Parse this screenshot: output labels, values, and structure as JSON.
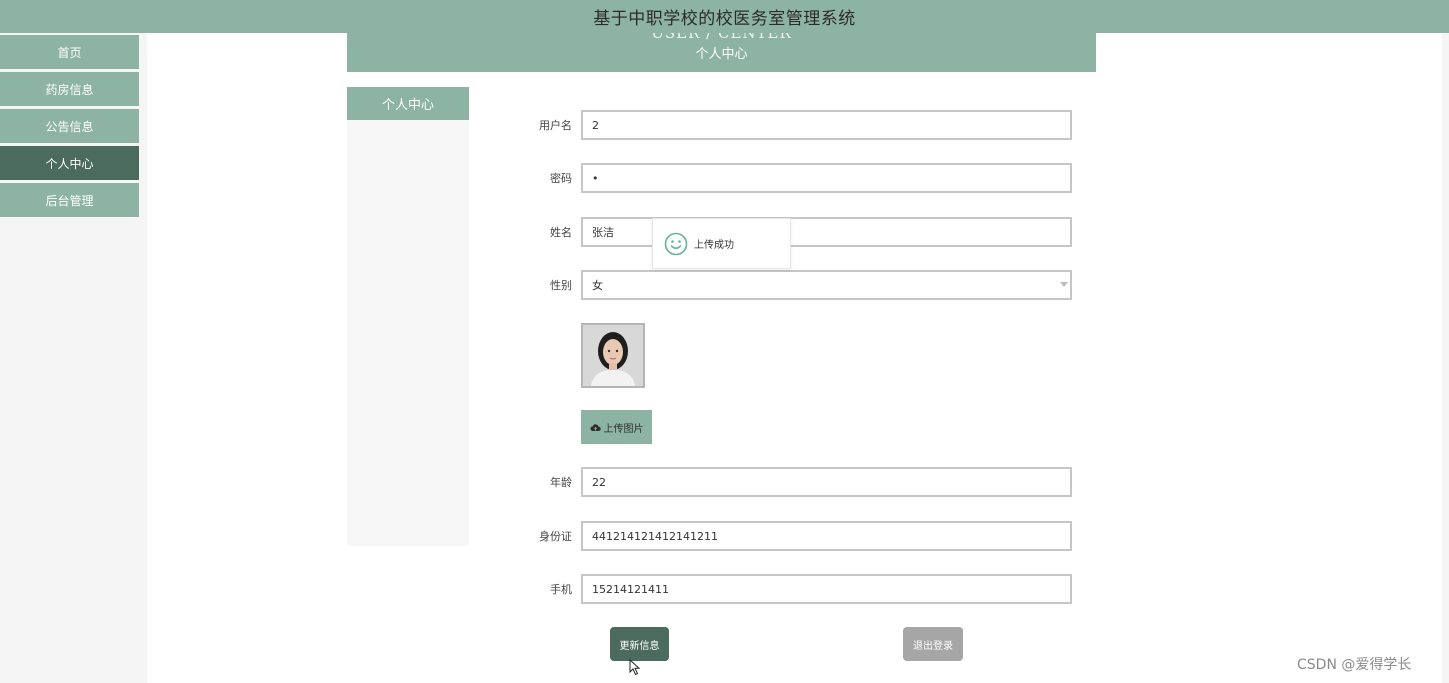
{
  "app": {
    "title": "基于中职学校的校医务室管理系统"
  },
  "sidebar": {
    "items": [
      {
        "label": "首页",
        "active": false
      },
      {
        "label": "药房信息",
        "active": false
      },
      {
        "label": "公告信息",
        "active": false
      },
      {
        "label": "个人中心",
        "active": true
      },
      {
        "label": "后台管理",
        "active": false
      }
    ]
  },
  "banner": {
    "en": "USER / CENTER",
    "cn": "个人中心"
  },
  "panel": {
    "tab_label": "个人中心"
  },
  "form": {
    "username": {
      "label": "用户名",
      "value": "2"
    },
    "password": {
      "label": "密码",
      "value": "•"
    },
    "name": {
      "label": "姓名",
      "value": "张洁"
    },
    "gender": {
      "label": "性别",
      "value": "女"
    },
    "upload_label": "上传图片",
    "age": {
      "label": "年龄",
      "value": "22"
    },
    "id_card": {
      "label": "身份证",
      "value": "441214121412141211"
    },
    "phone": {
      "label": "手机",
      "value": "15214121411"
    }
  },
  "toast": {
    "message": "上传成功"
  },
  "actions": {
    "update_label": "更新信息",
    "logout_label": "退出登录"
  },
  "watermark": "CSDN @爱得学长",
  "colors": {
    "primary": "#8db3a5",
    "active": "#4c6b5f",
    "gray_button": "#a6a6a6"
  }
}
